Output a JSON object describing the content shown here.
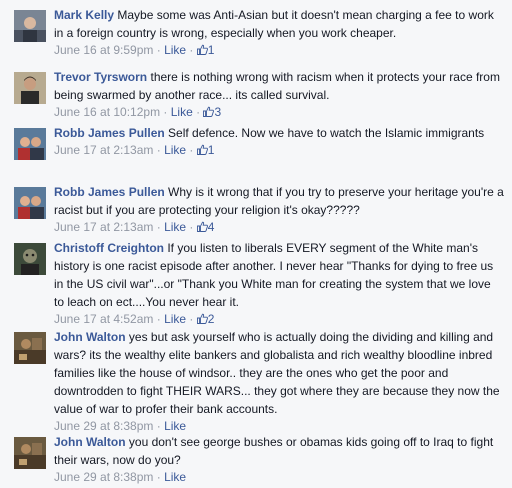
{
  "comments": [
    {
      "author": "Mark Kelly",
      "text": "Maybe some was Anti-Asian but it doesn't mean charging a fee to work in a foreign country is wrong, especially when you work cheaper.",
      "time": "June 16 at 9:59pm",
      "like_label": "Like",
      "like_count": "1",
      "avatar_icon": "profile-photo-mark-kelly"
    },
    {
      "author": "Trevor Tyrsworn",
      "text": "there is nothing wrong with racism when it protects your race from being swarmed by another race... its called survival.",
      "time": "June 16 at 10:12pm",
      "like_label": "Like",
      "like_count": "3",
      "avatar_icon": "profile-photo-trevor-tyrsworn"
    },
    {
      "author": "Robb James Pullen",
      "text": "Self defence. Now we have to watch the Islamic immigrants",
      "time": "June 17 at 2:13am",
      "like_label": "Like",
      "like_count": "1",
      "avatar_icon": "profile-photo-robb-james-pullen"
    },
    {
      "author": "Robb James Pullen",
      "text": "Why is it wrong that if you try to preserve your heritage you're a racist but if you are protecting your religion it's okay?????",
      "time": "June 17 at 2:13am",
      "like_label": "Like",
      "like_count": "4",
      "avatar_icon": "profile-photo-robb-james-pullen"
    },
    {
      "author": "Christoff Creighton",
      "text": "If you listen to liberals EVERY segment of the White man's history is one racist episode after another. I never hear \"Thanks for dying to free us in the US civil war\"...or \"Thank you White man for creating the system that we love to leach on ect....You never hear it.",
      "time": "June 17 at 4:52am",
      "like_label": "Like",
      "like_count": "2",
      "avatar_icon": "profile-photo-christoff-creighton"
    },
    {
      "author": "John Walton",
      "text": "yes but ask yourself who is actually doing the dividing and killing and wars? its the wealthy elite bankers and globalista and rich wealthy bloodline inbred families like the house of windsor.. they are the ones who get the poor and downtrodden to fight THEIR WARS... they got where they are because they now the value of war to profer their bank accounts.",
      "time": "June 29 at 8:38pm",
      "like_label": "Like",
      "like_count": "",
      "avatar_icon": "profile-photo-john-walton"
    },
    {
      "author": "John Walton",
      "text": "you don't see george bushes or obamas kids going off to Iraq to fight their wars, now do you?",
      "time": "June 29 at 8:38pm",
      "like_label": "Like",
      "like_count": "",
      "avatar_icon": "profile-photo-john-walton"
    }
  ],
  "colors": {
    "background": "#f6f7f9",
    "link": "#3b5998",
    "meta": "#9197a3",
    "text": "#141823"
  },
  "icons": {
    "like_count_icon": "thumbs-up-icon"
  }
}
